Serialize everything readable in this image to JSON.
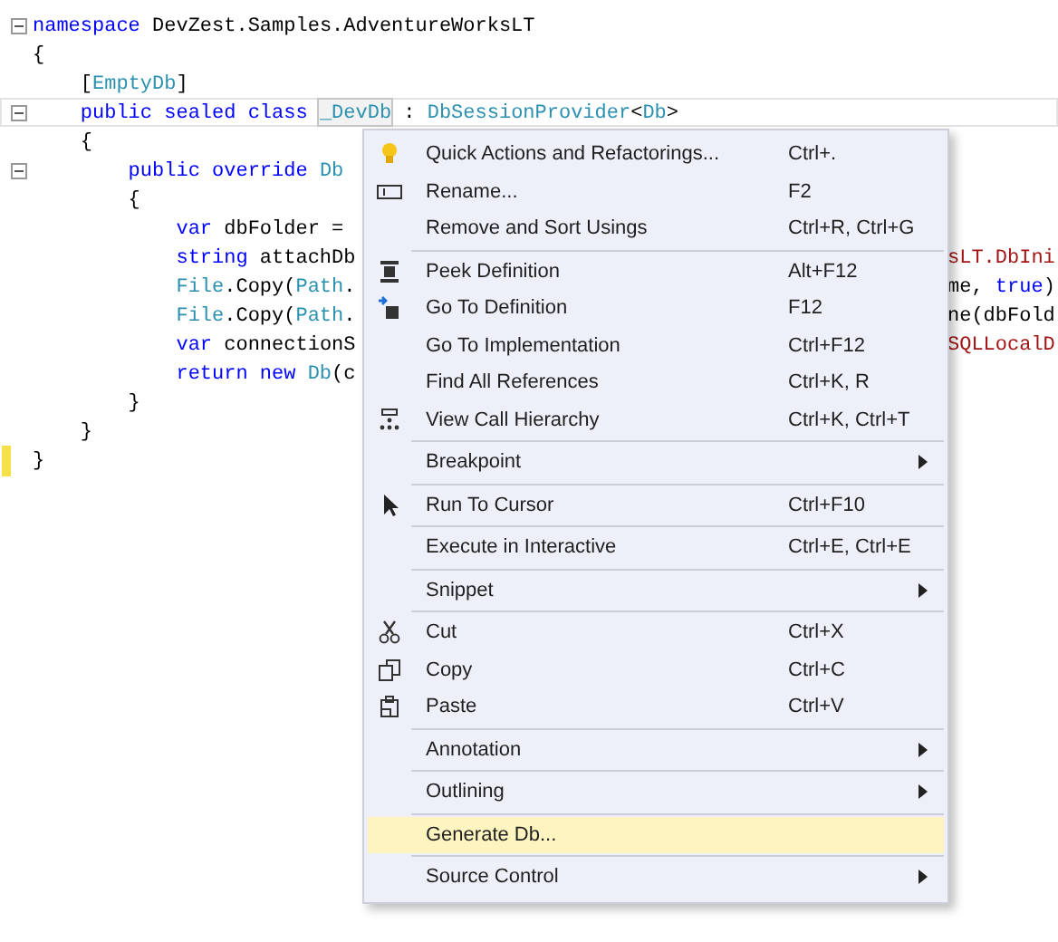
{
  "code_lines": [
    {
      "expanded": true,
      "changed": false,
      "current": false,
      "tokens": [
        {
          "text": "namespace",
          "kind": "keyword"
        },
        {
          "text": " DevZest.Samples.AdventureWorksLT",
          "kind": "plain"
        }
      ]
    },
    {
      "changed": false,
      "current": false,
      "tokens": [
        {
          "text": "{",
          "kind": "plain"
        }
      ]
    },
    {
      "changed": false,
      "current": false,
      "tokens": [
        {
          "text": "    [",
          "kind": "plain"
        },
        {
          "text": "EmptyDb",
          "kind": "type"
        },
        {
          "text": "]",
          "kind": "plain"
        }
      ]
    },
    {
      "expanded": true,
      "changed": false,
      "current": true,
      "tokens": [
        {
          "text": "    public sealed class ",
          "kind": "keyword"
        },
        {
          "text": "_DevDb",
          "kind": "marked"
        },
        {
          "text": " : ",
          "kind": "plain"
        },
        {
          "text": "DbSessionProvider",
          "kind": "type"
        },
        {
          "text": "<",
          "kind": "plain"
        },
        {
          "text": "Db",
          "kind": "type"
        },
        {
          "text": ">",
          "kind": "plain"
        }
      ]
    },
    {
      "changed": false,
      "current": false,
      "tokens": [
        {
          "text": "    {",
          "kind": "plain"
        }
      ]
    },
    {
      "expanded": true,
      "changed": false,
      "current": false,
      "tokens": [
        {
          "text": "        public override ",
          "kind": "keyword"
        },
        {
          "text": "Db",
          "kind": "type"
        }
      ]
    },
    {
      "changed": false,
      "current": false,
      "tokens": [
        {
          "text": "        {",
          "kind": "plain"
        }
      ]
    },
    {
      "changed": false,
      "current": false,
      "tokens": [
        {
          "text": "            var",
          "kind": "keyword"
        },
        {
          "text": " dbFolder =",
          "kind": "plain"
        }
      ]
    },
    {
      "changed": false,
      "current": false,
      "tokens": [
        {
          "text": "            string",
          "kind": "keyword"
        },
        {
          "text": " attachDb",
          "kind": "plain"
        }
      ],
      "tail": [
        {
          "text": "sLT.DbIni",
          "kind": "string"
        }
      ]
    },
    {
      "changed": false,
      "current": false,
      "tokens": [
        {
          "text": "            File",
          "kind": "type"
        },
        {
          "text": ".Copy(",
          "kind": "plain"
        },
        {
          "text": "Path",
          "kind": "type"
        },
        {
          "text": ".",
          "kind": "plain"
        }
      ],
      "tail": [
        {
          "text": "me, ",
          "kind": "plain"
        },
        {
          "text": "true",
          "kind": "keyword"
        },
        {
          "text": ")",
          "kind": "plain"
        }
      ]
    },
    {
      "changed": false,
      "current": false,
      "tokens": [
        {
          "text": "            File",
          "kind": "type"
        },
        {
          "text": ".Copy(",
          "kind": "plain"
        },
        {
          "text": "Path",
          "kind": "type"
        },
        {
          "text": ".",
          "kind": "plain"
        }
      ],
      "tail": [
        {
          "text": "ne(dbFold",
          "kind": "plain"
        }
      ]
    },
    {
      "changed": false,
      "current": false,
      "tokens": [
        {
          "text": "            var",
          "kind": "keyword"
        },
        {
          "text": " connectionS",
          "kind": "plain"
        }
      ],
      "tail": [
        {
          "text": "SQLLocalD",
          "kind": "string"
        }
      ]
    },
    {
      "changed": false,
      "current": false,
      "tokens": [
        {
          "text": "            return new ",
          "kind": "keyword"
        },
        {
          "text": "Db",
          "kind": "type"
        },
        {
          "text": "(c",
          "kind": "plain"
        }
      ]
    },
    {
      "changed": false,
      "current": false,
      "tokens": [
        {
          "text": "        }",
          "kind": "plain"
        }
      ]
    },
    {
      "changed": false,
      "current": false,
      "tokens": [
        {
          "text": "    }",
          "kind": "plain"
        }
      ]
    },
    {
      "changed": true,
      "current": false,
      "tokens": [
        {
          "text": "}",
          "kind": "plain"
        }
      ]
    }
  ],
  "context_menu": {
    "items": [
      {
        "kind": "item",
        "label": "Quick Actions and Refactorings...",
        "shortcut": "Ctrl+.",
        "submenu": false,
        "selected": false
      },
      {
        "kind": "item",
        "label": "Rename...",
        "shortcut": "F2",
        "submenu": false,
        "selected": false
      },
      {
        "kind": "item",
        "label": "Remove and Sort Usings",
        "shortcut": "Ctrl+R, Ctrl+G",
        "submenu": false,
        "selected": false
      },
      {
        "kind": "separator"
      },
      {
        "kind": "item",
        "label": "Peek Definition",
        "shortcut": "Alt+F12",
        "submenu": false,
        "selected": false
      },
      {
        "kind": "item",
        "label": "Go To Definition",
        "shortcut": "F12",
        "submenu": false,
        "selected": false
      },
      {
        "kind": "item",
        "label": "Go To Implementation",
        "shortcut": "Ctrl+F12",
        "submenu": false,
        "selected": false
      },
      {
        "kind": "item",
        "label": "Find All References",
        "shortcut": "Ctrl+K, R",
        "submenu": false,
        "selected": false
      },
      {
        "kind": "item",
        "label": "View Call Hierarchy",
        "shortcut": "Ctrl+K, Ctrl+T",
        "submenu": false,
        "selected": false
      },
      {
        "kind": "separator"
      },
      {
        "kind": "item",
        "label": "Breakpoint",
        "submenu": true,
        "selected": false
      },
      {
        "kind": "separator"
      },
      {
        "kind": "item",
        "label": "Run To Cursor",
        "shortcut": "Ctrl+F10",
        "submenu": false,
        "selected": false
      },
      {
        "kind": "separator"
      },
      {
        "kind": "item",
        "label": "Execute in Interactive",
        "shortcut": "Ctrl+E, Ctrl+E",
        "submenu": false,
        "selected": false
      },
      {
        "kind": "separator"
      },
      {
        "kind": "item",
        "label": "Snippet",
        "submenu": true,
        "selected": false
      },
      {
        "kind": "separator"
      },
      {
        "kind": "item",
        "label": "Cut",
        "shortcut": "Ctrl+X",
        "submenu": false,
        "selected": false
      },
      {
        "kind": "item",
        "label": "Copy",
        "shortcut": "Ctrl+C",
        "submenu": false,
        "selected": false
      },
      {
        "kind": "item",
        "label": "Paste",
        "shortcut": "Ctrl+V",
        "submenu": false,
        "selected": false
      },
      {
        "kind": "separator"
      },
      {
        "kind": "item",
        "label": "Annotation",
        "submenu": true,
        "selected": false
      },
      {
        "kind": "separator"
      },
      {
        "kind": "item",
        "label": "Outlining",
        "submenu": true,
        "selected": false
      },
      {
        "kind": "separator"
      },
      {
        "kind": "item",
        "label": "Generate Db...",
        "submenu": false,
        "selected": true
      },
      {
        "kind": "separator"
      },
      {
        "kind": "item",
        "label": "Source Control",
        "submenu": true,
        "selected": false
      }
    ]
  }
}
